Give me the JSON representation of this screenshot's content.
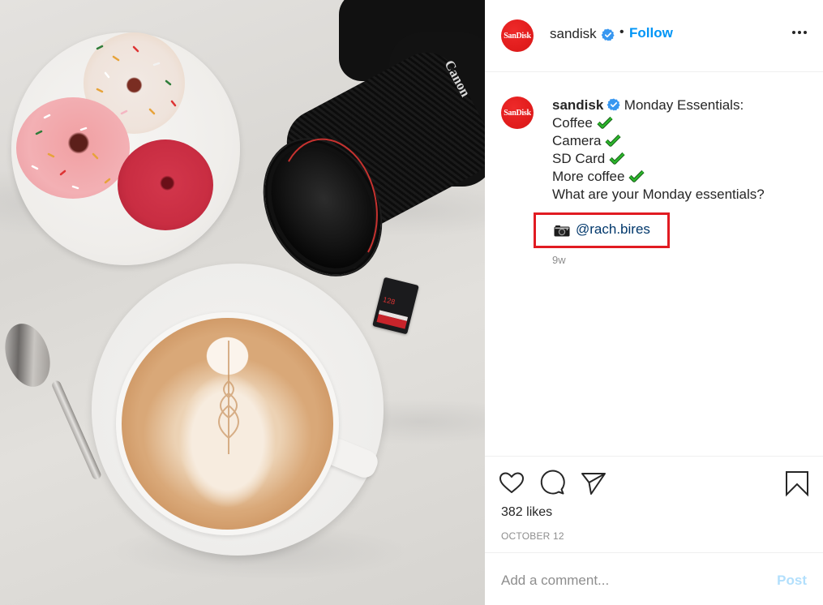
{
  "post": {
    "account": {
      "username": "sandisk",
      "avatar_text": "SanDisk",
      "verified": true,
      "follow_label": "Follow",
      "separator": "•"
    },
    "photo": {
      "description": "Flat-lay on marble: plate of three sprinkled donuts, latte with heart/rosetta art on saucer, spoon, Canon camera with lens, SanDisk 128GB SD card",
      "sd_card_label": "128"
    },
    "caption": {
      "username": "sandisk",
      "lines": [
        "Monday Essentials:",
        "Coffee",
        "Camera",
        "SD Card",
        "More coffee",
        "What are your Monday essentials?"
      ],
      "checked_items": [
        "Coffee",
        "Camera",
        "SD Card",
        "More coffee"
      ],
      "photo_credit": "@rach.bires",
      "time_ago": "9w"
    },
    "engagement": {
      "likes": "382 likes",
      "date": "OCTOBER 12"
    },
    "comment": {
      "placeholder": "Add a comment...",
      "value": "",
      "post_label": "Post"
    }
  },
  "colors": {
    "follow": "#0095f6",
    "brand_red": "#e21d1d",
    "highlight_box": "#e11b22",
    "link": "#00376b",
    "check_green": "#2bb52b",
    "post_disabled": "#b2dffc",
    "muted": "#8e8e8e"
  },
  "icons": {
    "more": "more-horizontal-icon",
    "like": "heart-icon",
    "comment": "comment-bubble-icon",
    "share": "paper-plane-icon",
    "save": "bookmark-icon",
    "credit": "camera-emoji-icon",
    "check": "check-mark-icon",
    "verified": "verified-badge-icon"
  }
}
